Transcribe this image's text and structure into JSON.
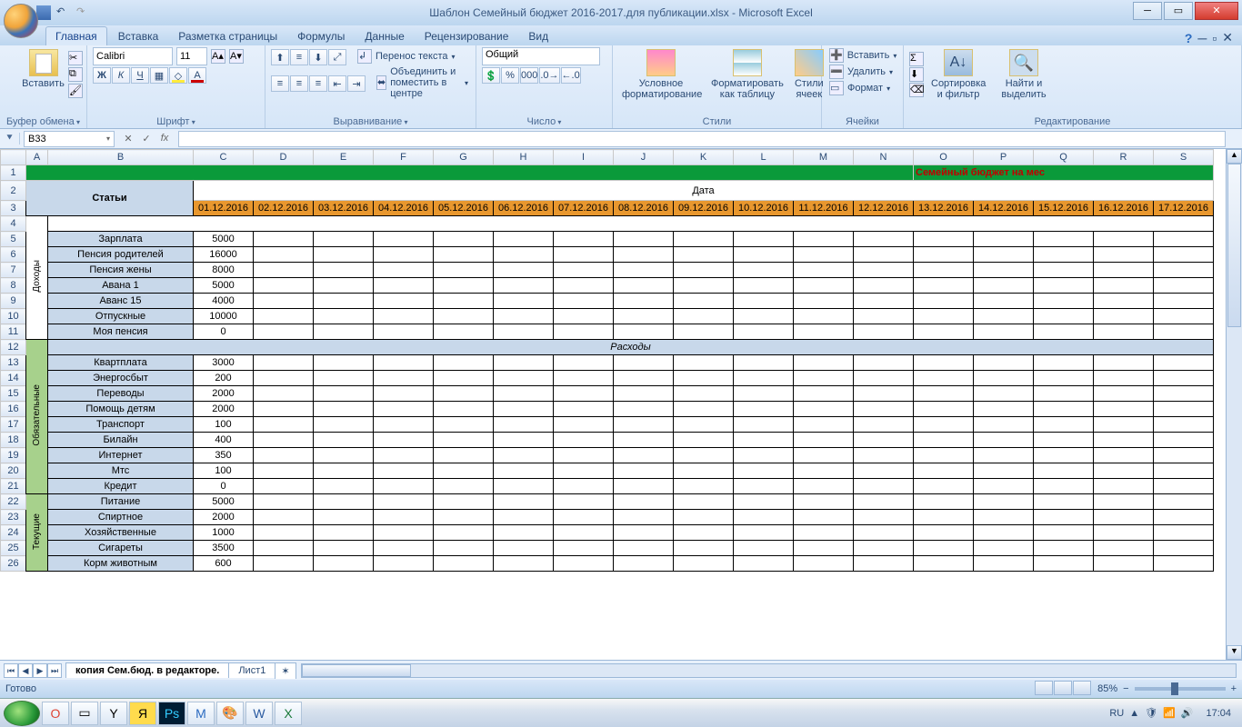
{
  "window": {
    "title": "Шаблон Семейный бюджет 2016-2017.для публикации.xlsx - Microsoft Excel"
  },
  "tabs": {
    "home": "Главная",
    "insert": "Вставка",
    "pagelayout": "Разметка страницы",
    "formulas": "Формулы",
    "data": "Данные",
    "review": "Рецензирование",
    "view": "Вид"
  },
  "ribbon": {
    "clipboard": {
      "paste": "Вставить",
      "label": "Буфер обмена"
    },
    "font": {
      "name": "Calibri",
      "size": "11",
      "bold": "Ж",
      "italic": "К",
      "underline": "Ч",
      "label": "Шрифт"
    },
    "alignment": {
      "wrap": "Перенос текста",
      "merge": "Объединить и поместить в центре",
      "label": "Выравнивание"
    },
    "number": {
      "format": "Общий",
      "label": "Число"
    },
    "styles": {
      "cond": "Условное форматирование",
      "table": "Форматировать как таблицу",
      "cell": "Стили ячеек",
      "label": "Стили"
    },
    "cells": {
      "insert": "Вставить",
      "delete": "Удалить",
      "format": "Формат",
      "label": "Ячейки"
    },
    "editing": {
      "sort": "Сортировка и фильтр",
      "find": "Найти и выделить",
      "label": "Редактирование"
    }
  },
  "namebox": "B33",
  "columns": [
    "A",
    "B",
    "C",
    "D",
    "E",
    "F",
    "G",
    "H",
    "I",
    "J",
    "K",
    "L",
    "M",
    "N",
    "O",
    "P",
    "Q",
    "R",
    "S"
  ],
  "dates": [
    "01.12.2016",
    "02.12.2016",
    "03.12.2016",
    "04.12.2016",
    "05.12.2016",
    "06.12.2016",
    "07.12.2016",
    "08.12.2016",
    "09.12.2016",
    "10.12.2016",
    "11.12.2016",
    "12.12.2016",
    "13.12.2016",
    "14.12.2016",
    "15.12.2016",
    "16.12.2016",
    "17.12.2016"
  ],
  "sheet": {
    "bigtitle": "Семейный бюджет на мес",
    "stat": "Статьи",
    "date": "Дата",
    "expenses_label": "Расходы",
    "side_income": "Доходы",
    "side_mand": "Обязательные",
    "side_cur": "Текущие"
  },
  "income": [
    {
      "label": "Зарплата",
      "val": "5000"
    },
    {
      "label": "Пенсия родителей",
      "val": "16000"
    },
    {
      "label": "Пенсия жены",
      "val": "8000"
    },
    {
      "label": "Авана 1",
      "val": "5000"
    },
    {
      "label": "Аванс 15",
      "val": "4000"
    },
    {
      "label": "Отпускные",
      "val": "10000"
    },
    {
      "label": "Моя пенсия",
      "val": "0"
    }
  ],
  "mandatory": [
    {
      "label": "Квартплата",
      "val": "3000"
    },
    {
      "label": "Энергосбыт",
      "val": "200"
    },
    {
      "label": "Переводы",
      "val": "2000"
    },
    {
      "label": "Помощь детям",
      "val": "2000"
    },
    {
      "label": "Транспорт",
      "val": "100"
    },
    {
      "label": "Билайн",
      "val": "400"
    },
    {
      "label": "Интернет",
      "val": "350"
    },
    {
      "label": "Мтс",
      "val": "100"
    },
    {
      "label": "Кредит",
      "val": "0"
    }
  ],
  "current": [
    {
      "label": "Питание",
      "val": "5000"
    },
    {
      "label": "Спиртное",
      "val": "2000"
    },
    {
      "label": "Хозяйственные",
      "val": "1000"
    },
    {
      "label": "Сигареты",
      "val": "3500"
    },
    {
      "label": "Корм животным",
      "val": "600"
    }
  ],
  "sheettabs": {
    "t1": "копия Сем.бюд. в редакторе.",
    "t2": "Лист1"
  },
  "status": {
    "ready": "Готово",
    "zoom": "85%"
  },
  "taskbar": {
    "lang": "RU",
    "time": "17:04"
  }
}
